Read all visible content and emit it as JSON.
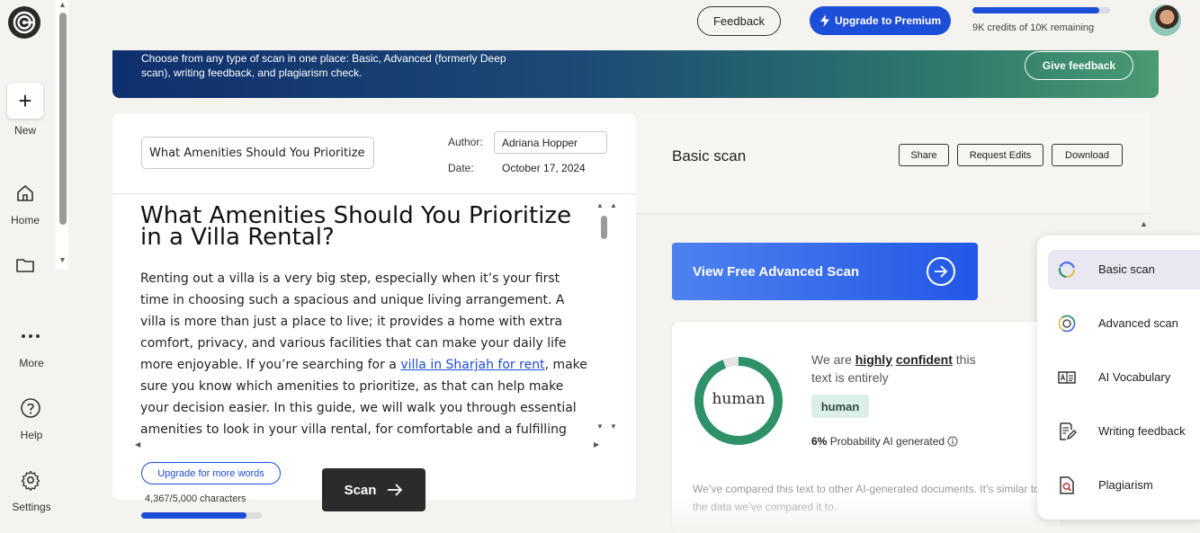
{
  "sidebar": {
    "new_label": "New",
    "items": [
      {
        "label": "Home"
      },
      {
        "label": "More"
      },
      {
        "label": "Help"
      },
      {
        "label": "Settings"
      }
    ]
  },
  "topbar": {
    "feedback_label": "Feedback",
    "upgrade_label": "Upgrade to Premium",
    "credits_text": "9K credits of 10K remaining",
    "credits_fraction": 0.92
  },
  "banner": {
    "text": "Choose from any type of scan in one place: Basic, Advanced (formerly Deep scan), writing feedback, and plagiarism check.",
    "button_label": "Give feedback"
  },
  "editor": {
    "title_value": "What Amenities Should You Prioritize in a Villa Rental?",
    "author_label": "Author:",
    "author_value": "Adriana Hopper",
    "date_label": "Date:",
    "date_value": "October 17, 2024",
    "heading": "What Amenities Should You Prioritize in a Villa Rental?",
    "body_before_link": "Renting out a villa is a very big step, especially when it’s your first time in choosing such a spacious and unique living arrangement. A villa is more than just a place to live; it provides a home with extra comfort, privacy, and various facilities that can make your daily life more enjoyable. If you’re searching for a ",
    "body_link": "villa in Sharjah for rent",
    "body_after_link": ", make sure you know which amenities to prioritize, as that can help make your decision easier. In this guide, we will walk you through essential amenities to look in your villa rental, for comfortable and a fulfilling",
    "upgrade_words_label": "Upgrade for more words",
    "char_count": "4,367/5,000 characters",
    "char_fraction": 0.87,
    "scan_label": "Scan"
  },
  "results": {
    "title": "Basic scan",
    "share_label": "Share",
    "request_edits_label": "Request Edits",
    "download_label": "Download",
    "advanced_scan_label": "View Free Advanced Scan",
    "donut_label": "human",
    "human_fraction": 0.94,
    "confidence_prefix": "We are ",
    "confidence_word1": "highly",
    "confidence_word2": "confident",
    "confidence_suffix": " this text is entirely",
    "verdict_badge": "human",
    "prob_value": "6%",
    "prob_text": "Probability AI generated",
    "compare_text": "We’ve compared this text to other AI-generated documents. It’s similar to the data we’ve compared it to.",
    "colors": {
      "human": "#2f9168",
      "ai_remainder": "#e4e4e4",
      "accent": "#1c4ed8"
    }
  },
  "scan_menu": [
    {
      "label": "Basic scan",
      "icon": "basic-scan-icon",
      "active": true
    },
    {
      "label": "Advanced scan",
      "icon": "advanced-scan-icon",
      "active": false
    },
    {
      "label": "AI Vocabulary",
      "icon": "ai-vocabulary-icon",
      "active": false
    },
    {
      "label": "Writing feedback",
      "icon": "writing-feedback-icon",
      "active": false
    },
    {
      "label": "Plagiarism",
      "icon": "plagiarism-icon",
      "active": false
    }
  ]
}
